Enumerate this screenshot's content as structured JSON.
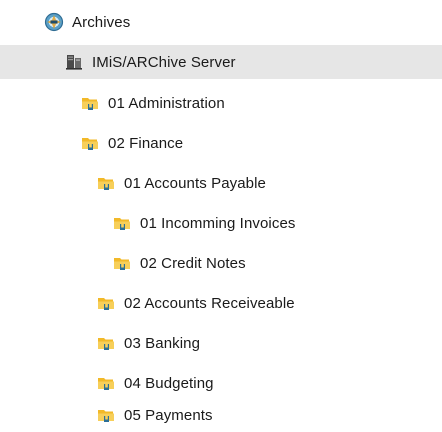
{
  "tree": {
    "root": {
      "label": "Archives",
      "icon": "archive-app-icon"
    },
    "server": {
      "label": "IMiS/ARChive Server",
      "icon": "server-icon",
      "selected": true
    },
    "items": [
      {
        "label": "01 Administration",
        "icon": "folder-icon"
      },
      {
        "label": "02 Finance",
        "icon": "folder-icon"
      },
      {
        "label": "01 Accounts Payable",
        "icon": "folder-icon"
      },
      {
        "label": "01 Incomming Invoices",
        "icon": "folder-icon"
      },
      {
        "label": "02 Credit Notes",
        "icon": "folder-icon"
      },
      {
        "label": "02 Accounts Receiveable",
        "icon": "folder-icon"
      },
      {
        "label": "03 Banking",
        "icon": "folder-icon"
      },
      {
        "label": "04 Budgeting",
        "icon": "folder-icon"
      },
      {
        "label": "05 Payments",
        "icon": "folder-icon"
      }
    ]
  },
  "colors": {
    "selection": "#e6e6e6",
    "folder_body": "#f2b929",
    "folder_front": "#f7cf5a",
    "folder_clip": "#2d6f96"
  }
}
